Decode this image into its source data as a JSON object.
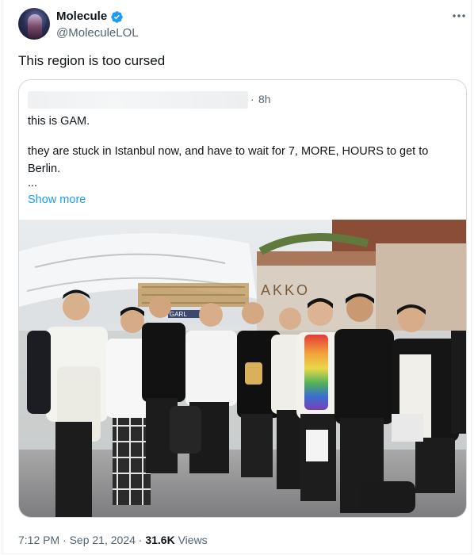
{
  "author": {
    "display_name": "Molecule",
    "handle": "@MoleculeLOL",
    "verified": true
  },
  "tweet": {
    "text": "This region is too cursed"
  },
  "quoted_tweet": {
    "separator": "·",
    "time": "8h",
    "lines": [
      "this is GAM.",
      "they are stuck in Istanbul now, and have to wait for 7, MORE, HOURS to get to",
      "Berlin.",
      "..."
    ],
    "show_more_label": "Show more",
    "photo_signage": {
      "store_sign": "AKKO",
      "gate_sign": "GARL"
    }
  },
  "meta": {
    "time": "7:12 PM",
    "separator1": "·",
    "date": "Sep 21, 2024",
    "separator2": "·",
    "views_count": "31.6K",
    "views_label": "Views"
  },
  "icons": {
    "verified": "verified-badge-icon",
    "more": "more-options-icon"
  },
  "colors": {
    "accent": "#1d9bf0",
    "secondary_text": "#536471",
    "primary_text": "#0f1419",
    "border": "#cfd9de"
  }
}
